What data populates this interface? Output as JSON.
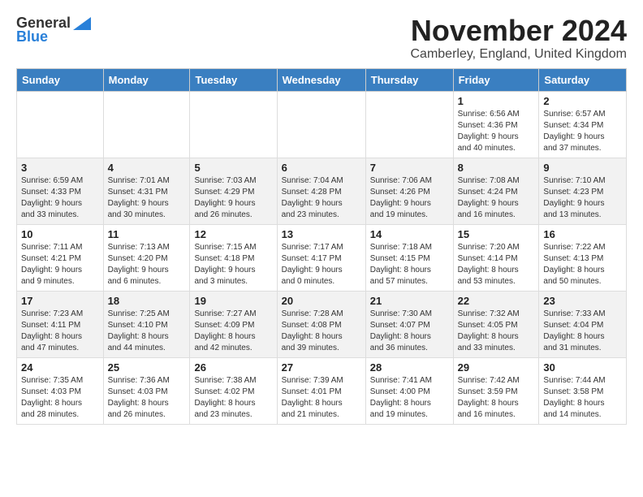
{
  "header": {
    "logo_line1": "General",
    "logo_line2": "Blue",
    "month_title": "November 2024",
    "location": "Camberley, England, United Kingdom"
  },
  "days_of_week": [
    "Sunday",
    "Monday",
    "Tuesday",
    "Wednesday",
    "Thursday",
    "Friday",
    "Saturday"
  ],
  "weeks": [
    [
      {
        "day": "",
        "info": ""
      },
      {
        "day": "",
        "info": ""
      },
      {
        "day": "",
        "info": ""
      },
      {
        "day": "",
        "info": ""
      },
      {
        "day": "",
        "info": ""
      },
      {
        "day": "1",
        "info": "Sunrise: 6:56 AM\nSunset: 4:36 PM\nDaylight: 9 hours\nand 40 minutes."
      },
      {
        "day": "2",
        "info": "Sunrise: 6:57 AM\nSunset: 4:34 PM\nDaylight: 9 hours\nand 37 minutes."
      }
    ],
    [
      {
        "day": "3",
        "info": "Sunrise: 6:59 AM\nSunset: 4:33 PM\nDaylight: 9 hours\nand 33 minutes."
      },
      {
        "day": "4",
        "info": "Sunrise: 7:01 AM\nSunset: 4:31 PM\nDaylight: 9 hours\nand 30 minutes."
      },
      {
        "day": "5",
        "info": "Sunrise: 7:03 AM\nSunset: 4:29 PM\nDaylight: 9 hours\nand 26 minutes."
      },
      {
        "day": "6",
        "info": "Sunrise: 7:04 AM\nSunset: 4:28 PM\nDaylight: 9 hours\nand 23 minutes."
      },
      {
        "day": "7",
        "info": "Sunrise: 7:06 AM\nSunset: 4:26 PM\nDaylight: 9 hours\nand 19 minutes."
      },
      {
        "day": "8",
        "info": "Sunrise: 7:08 AM\nSunset: 4:24 PM\nDaylight: 9 hours\nand 16 minutes."
      },
      {
        "day": "9",
        "info": "Sunrise: 7:10 AM\nSunset: 4:23 PM\nDaylight: 9 hours\nand 13 minutes."
      }
    ],
    [
      {
        "day": "10",
        "info": "Sunrise: 7:11 AM\nSunset: 4:21 PM\nDaylight: 9 hours\nand 9 minutes."
      },
      {
        "day": "11",
        "info": "Sunrise: 7:13 AM\nSunset: 4:20 PM\nDaylight: 9 hours\nand 6 minutes."
      },
      {
        "day": "12",
        "info": "Sunrise: 7:15 AM\nSunset: 4:18 PM\nDaylight: 9 hours\nand 3 minutes."
      },
      {
        "day": "13",
        "info": "Sunrise: 7:17 AM\nSunset: 4:17 PM\nDaylight: 9 hours\nand 0 minutes."
      },
      {
        "day": "14",
        "info": "Sunrise: 7:18 AM\nSunset: 4:15 PM\nDaylight: 8 hours\nand 57 minutes."
      },
      {
        "day": "15",
        "info": "Sunrise: 7:20 AM\nSunset: 4:14 PM\nDaylight: 8 hours\nand 53 minutes."
      },
      {
        "day": "16",
        "info": "Sunrise: 7:22 AM\nSunset: 4:13 PM\nDaylight: 8 hours\nand 50 minutes."
      }
    ],
    [
      {
        "day": "17",
        "info": "Sunrise: 7:23 AM\nSunset: 4:11 PM\nDaylight: 8 hours\nand 47 minutes."
      },
      {
        "day": "18",
        "info": "Sunrise: 7:25 AM\nSunset: 4:10 PM\nDaylight: 8 hours\nand 44 minutes."
      },
      {
        "day": "19",
        "info": "Sunrise: 7:27 AM\nSunset: 4:09 PM\nDaylight: 8 hours\nand 42 minutes."
      },
      {
        "day": "20",
        "info": "Sunrise: 7:28 AM\nSunset: 4:08 PM\nDaylight: 8 hours\nand 39 minutes."
      },
      {
        "day": "21",
        "info": "Sunrise: 7:30 AM\nSunset: 4:07 PM\nDaylight: 8 hours\nand 36 minutes."
      },
      {
        "day": "22",
        "info": "Sunrise: 7:32 AM\nSunset: 4:05 PM\nDaylight: 8 hours\nand 33 minutes."
      },
      {
        "day": "23",
        "info": "Sunrise: 7:33 AM\nSunset: 4:04 PM\nDaylight: 8 hours\nand 31 minutes."
      }
    ],
    [
      {
        "day": "24",
        "info": "Sunrise: 7:35 AM\nSunset: 4:03 PM\nDaylight: 8 hours\nand 28 minutes."
      },
      {
        "day": "25",
        "info": "Sunrise: 7:36 AM\nSunset: 4:03 PM\nDaylight: 8 hours\nand 26 minutes."
      },
      {
        "day": "26",
        "info": "Sunrise: 7:38 AM\nSunset: 4:02 PM\nDaylight: 8 hours\nand 23 minutes."
      },
      {
        "day": "27",
        "info": "Sunrise: 7:39 AM\nSunset: 4:01 PM\nDaylight: 8 hours\nand 21 minutes."
      },
      {
        "day": "28",
        "info": "Sunrise: 7:41 AM\nSunset: 4:00 PM\nDaylight: 8 hours\nand 19 minutes."
      },
      {
        "day": "29",
        "info": "Sunrise: 7:42 AM\nSunset: 3:59 PM\nDaylight: 8 hours\nand 16 minutes."
      },
      {
        "day": "30",
        "info": "Sunrise: 7:44 AM\nSunset: 3:58 PM\nDaylight: 8 hours\nand 14 minutes."
      }
    ]
  ]
}
